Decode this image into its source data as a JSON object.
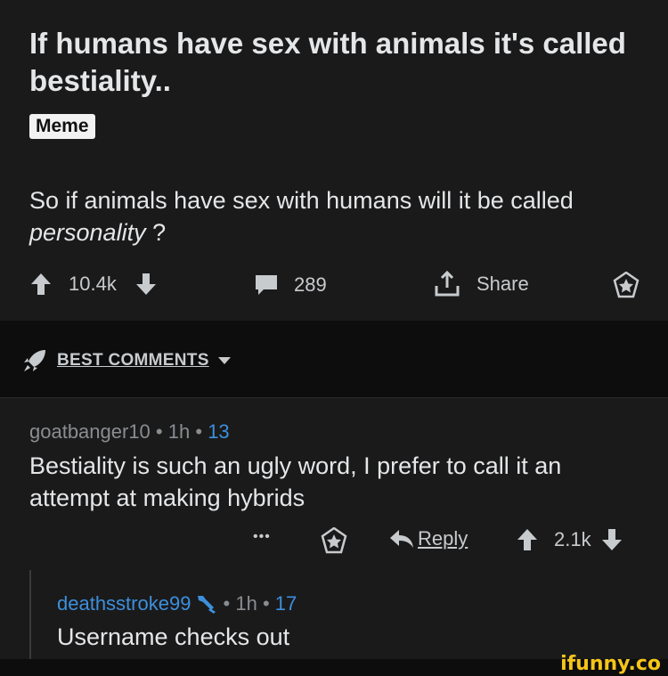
{
  "post": {
    "title": "If humans have sex with animals it's called bestiality..",
    "flair": "Meme",
    "body_prefix": "So if animals have sex with humans will it be called ",
    "body_italic": "personality",
    "body_suffix": " ?",
    "upvotes": "10.4k",
    "comments": "289",
    "share_label": "Share"
  },
  "sort": {
    "label": "BEST COMMENTS"
  },
  "comment1": {
    "author": "goatbanger10",
    "age": "1h",
    "score": "13",
    "text": "Bestiality is such an ugly word, I prefer to call it an attempt at making hybrids",
    "more": "•••",
    "reply_label": "Reply",
    "votes": "2.1k"
  },
  "comment2": {
    "author": "deathsstroke99",
    "age": "1h",
    "score": "17",
    "text": "Username checks out"
  },
  "watermark": "ifunny.co",
  "colors": {
    "accent_blue": "#3d8fdc",
    "watermark": "#f5c518",
    "background": "#1a1a1b"
  }
}
